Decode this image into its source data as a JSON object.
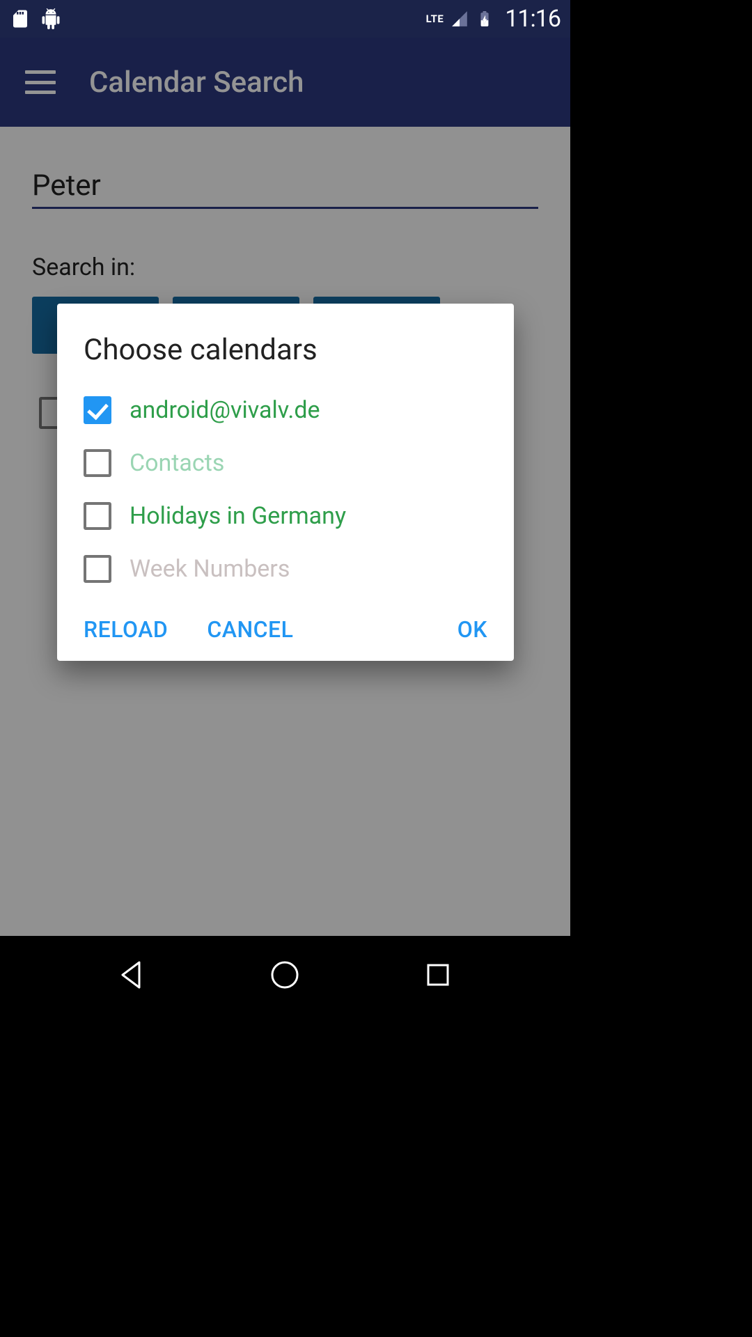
{
  "status": {
    "time": "11:16",
    "icons": {
      "sd": "sd-card-icon",
      "android": "android-icon",
      "lte": "LTE",
      "signal": "signal-icon",
      "battery": "battery-charging-icon"
    }
  },
  "appbar": {
    "title": "Calendar Search"
  },
  "search": {
    "value": "Peter",
    "in_label": "Search in:"
  },
  "dialog": {
    "title": "Choose calendars",
    "items": [
      {
        "label": "android@vivalv.de",
        "checked": true,
        "color": "c-green"
      },
      {
        "label": "Contacts",
        "checked": false,
        "color": "c-green-muted"
      },
      {
        "label": "Holidays in Germany",
        "checked": false,
        "color": "c-green"
      },
      {
        "label": "Week Numbers",
        "checked": false,
        "color": "c-gray"
      }
    ],
    "buttons": {
      "reload": "RELOAD",
      "cancel": "CANCEL",
      "ok": "OK"
    }
  }
}
